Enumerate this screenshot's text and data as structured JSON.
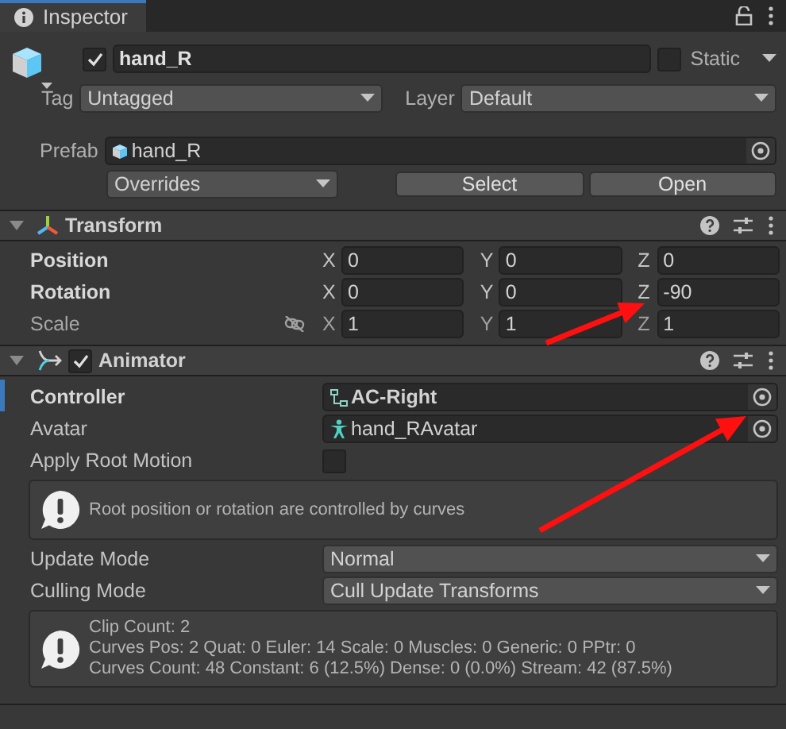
{
  "tab": {
    "title": "Inspector"
  },
  "object": {
    "active": true,
    "name": "hand_R",
    "static": false,
    "static_label": "Static",
    "tag_label": "Tag",
    "tag": "Untagged",
    "layer_label": "Layer",
    "layer": "Default"
  },
  "prefab": {
    "label": "Prefab",
    "asset": "hand_R",
    "overrides": "Overrides",
    "buttons": [
      "Select",
      "Open"
    ]
  },
  "transform": {
    "title": "Transform",
    "expanded": true,
    "rows": [
      {
        "label": "Position",
        "overridden": true,
        "proportional_toggle": false,
        "axes": [
          {
            "axis": "X",
            "value": "0"
          },
          {
            "axis": "Y",
            "value": "0"
          },
          {
            "axis": "Z",
            "value": "0"
          }
        ]
      },
      {
        "label": "Rotation",
        "overridden": true,
        "proportional_toggle": false,
        "axes": [
          {
            "axis": "X",
            "value": "0"
          },
          {
            "axis": "Y",
            "value": "0"
          },
          {
            "axis": "Z",
            "value": "-90"
          }
        ]
      },
      {
        "label": "Scale",
        "overridden": false,
        "proportional_toggle": true,
        "axes": [
          {
            "axis": "X",
            "value": "1"
          },
          {
            "axis": "Y",
            "value": "1"
          },
          {
            "axis": "Z",
            "value": "1"
          }
        ]
      }
    ]
  },
  "animator": {
    "title": "Animator",
    "enabled": true,
    "expanded": true,
    "properties": [
      {
        "kind": "object",
        "label": "Controller",
        "value": "AC-Right",
        "overridden": true
      },
      {
        "kind": "object",
        "label": "Avatar",
        "value": "hand_RAvatar",
        "overridden": false
      },
      {
        "kind": "checkbox",
        "label": "Apply Root Motion",
        "checked": false
      },
      {
        "kind": "help",
        "lines": [
          "Root position or rotation are controlled by curves"
        ]
      },
      {
        "kind": "dropdown",
        "label": "Update Mode",
        "value": "Normal"
      },
      {
        "kind": "dropdown",
        "label": "Culling Mode",
        "value": "Cull Update Transforms"
      },
      {
        "kind": "help",
        "lines": [
          "Clip Count: 2",
          "Curves Pos: 2 Quat: 0 Euler: 14 Scale: 0 Muscles: 0 Generic: 0 PPtr: 0",
          "Curves Count: 48 Constant: 6 (12.5%) Dense: 0 (0.0%) Stream: 42 (87.5%)"
        ]
      }
    ]
  }
}
